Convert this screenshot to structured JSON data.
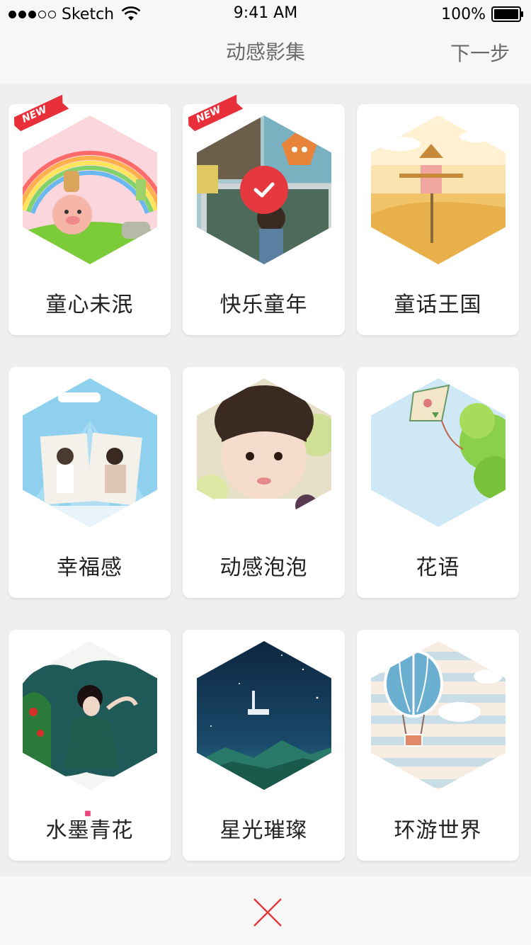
{
  "status_bar": {
    "carrier": "Sketch",
    "time": "9:41 AM",
    "battery": "100%"
  },
  "nav": {
    "title": "动感影集",
    "next_label": "下一步"
  },
  "templates": [
    {
      "label": "童心未泯",
      "new": true,
      "selected": false
    },
    {
      "label": "快乐童年",
      "new": true,
      "selected": true
    },
    {
      "label": "童话王国",
      "new": false,
      "selected": false
    },
    {
      "label": "幸福感",
      "new": false,
      "selected": false
    },
    {
      "label": "动感泡泡",
      "new": false,
      "selected": false
    },
    {
      "label": "花语",
      "new": false,
      "selected": false
    },
    {
      "label": "水墨青花",
      "new": false,
      "selected": false
    },
    {
      "label": "星光璀璨",
      "new": false,
      "selected": false
    },
    {
      "label": "环游世界",
      "new": false,
      "selected": false
    }
  ],
  "badge_text": "NEW",
  "colors": {
    "accent": "#e5393f",
    "nav_text": "#6b6b6b",
    "background": "#efefef"
  },
  "icons": {
    "close": "close-icon",
    "check": "check-icon"
  }
}
